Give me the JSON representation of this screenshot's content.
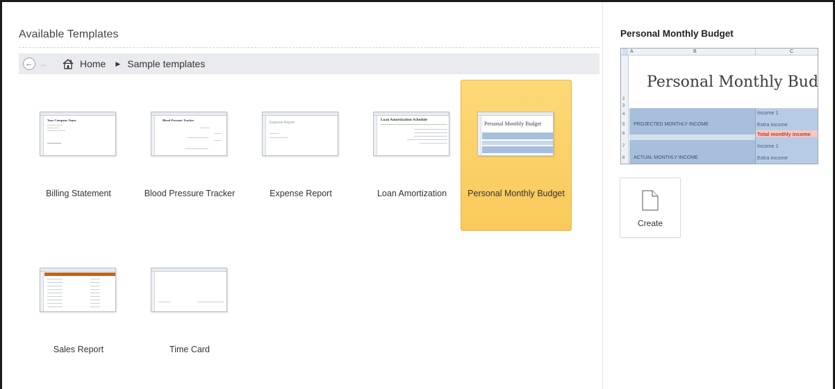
{
  "left_pane": {
    "title": "Available Templates",
    "breadcrumb": {
      "home": "Home",
      "current": "Sample templates"
    }
  },
  "templates": [
    {
      "label": "Billing Statement",
      "thumb_title": "Your Company Name",
      "selected": false
    },
    {
      "label": "Blood Pressure Tracker",
      "thumb_title": "Blood Pressure Tracker",
      "selected": false
    },
    {
      "label": "Expense Report",
      "thumb_title": "Expense Report",
      "selected": false
    },
    {
      "label": "Loan Amortization",
      "thumb_title": "Loan Amortization Schedule",
      "selected": false
    },
    {
      "label": "Personal Monthly Budget",
      "thumb_title": "Personal Monthly Budget",
      "selected": true
    },
    {
      "label": "Sales Report",
      "thumb_title": "",
      "selected": false
    },
    {
      "label": "Time Card",
      "thumb_title": "",
      "selected": false
    }
  ],
  "preview": {
    "title": "Personal Monthly Budget",
    "sheet_title": "Personal Monthly Bud",
    "columns": [
      "A",
      "B",
      "C"
    ],
    "rows": [
      {
        "num": "4",
        "left": "",
        "right": "Income 1"
      },
      {
        "num": "5",
        "left": "PROJECTED MONTHLY INCOME",
        "right": "Extra income"
      },
      {
        "num": "6",
        "left": "",
        "right": "Total monthly income"
      },
      {
        "num": "7",
        "left": "",
        "right": "Income 1"
      },
      {
        "num": "8",
        "left": "ACTUAL MONTHLY INCOME",
        "right": "Extra income"
      }
    ],
    "row_label_2": "2",
    "row_label_3": "3"
  },
  "create": {
    "label": "Create"
  },
  "colors": {
    "selected_tile": "#fbd06b",
    "band_blue": "#a7bfdc",
    "band_blue_light": "#c6d7ec",
    "total_pink": "#f3c9c4",
    "total_text": "#c0392b"
  }
}
